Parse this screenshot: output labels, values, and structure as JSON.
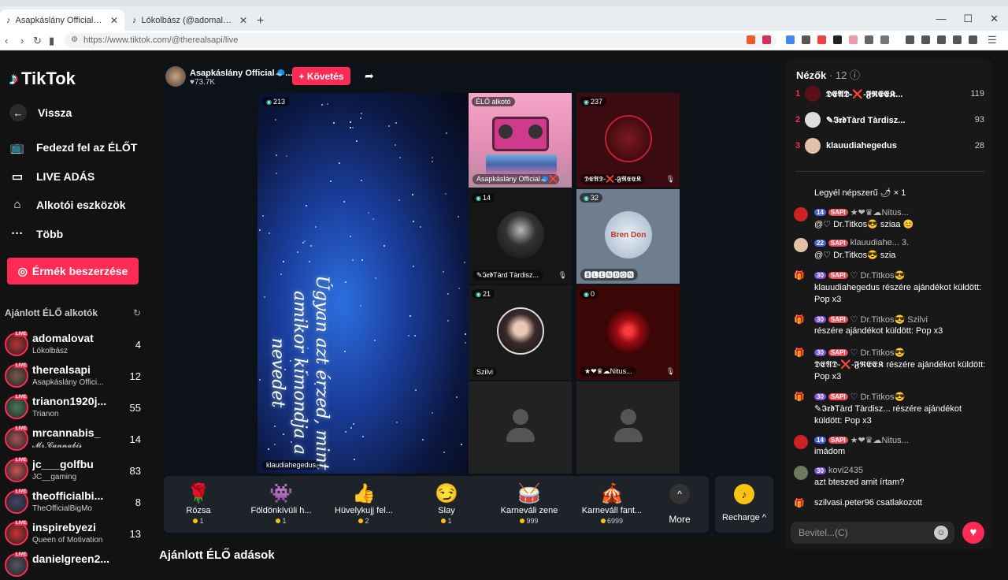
{
  "browser": {
    "tabs": [
      {
        "title": "Asapkáslány Official🧢❌ (@"
      },
      {
        "title": "Lókolbász (@adomalovat) ÉLŐ adásb"
      }
    ],
    "url": "https://www.tiktok.com/@therealsapi/live"
  },
  "sidebar": {
    "logo": "TikTok",
    "back": "Vissza",
    "nav": [
      "Fedezd fel az ÉLŐT",
      "LIVE ADÁS",
      "Alkotói eszközök",
      "Több"
    ],
    "coins_button": "Érmék beszerzése",
    "suggested_title": "Ajánlott ÉLŐ alkotók",
    "live_tag": "LIVE",
    "suggested": [
      {
        "name": "adomalovat",
        "sub": "Lókolbász",
        "count": "4"
      },
      {
        "name": "therealsapi",
        "sub": "Asapkáslány Offici...",
        "count": "12"
      },
      {
        "name": "trianon1920j...",
        "sub": "Trianon",
        "count": "55"
      },
      {
        "name": "mrcannabis_",
        "sub": "𝓜𝓻.𝓒𝓪𝓷𝓷𝓪𝓫𝓲𝓼",
        "count": "14"
      },
      {
        "name": "jc___golfbu",
        "sub": "JC__gaming",
        "count": "83"
      },
      {
        "name": "theofficialbi...",
        "sub": "TheOfficialBigMo",
        "count": "8"
      },
      {
        "name": "inspirebyezi",
        "sub": "Queen of Motivation",
        "count": "13"
      },
      {
        "name": "danielgreen2...",
        "sub": "",
        "count": ""
      }
    ]
  },
  "host": {
    "name": "Asapkáslány Official🧢...",
    "likes": "♥73.7K",
    "follow": "+ Követés"
  },
  "main_video": {
    "viewers": "213",
    "poem": "Úgyan azt érzed, mint amikor kimondja a nevedet",
    "label": "klaudiahegedus"
  },
  "tiles": [
    {
      "badge": "ÉLŐ alkotó",
      "label": "Asapkáslány Official🧢❌"
    },
    {
      "badge": "237",
      "label": "𝕯𝕰𝕬𝕯-❌-𝕱𝕽𝕰𝕰𝕶"
    },
    {
      "badge": "14",
      "label": "✎𝕴𝖗𝖉Tàrd Tàrdisz..."
    },
    {
      "badge": "32",
      "label": "🅱🅻🅴🅽🅳🅾🅽"
    },
    {
      "badge": "21",
      "label": "Szilvi"
    },
    {
      "badge": "0",
      "label": "★❤♛☁Nitus..."
    }
  ],
  "tile_art": {
    "bren": "Bren Don"
  },
  "gifts": [
    {
      "icon": "🌹",
      "name": "Rózsa",
      "price": "1"
    },
    {
      "icon": "👾",
      "name": "Földönkívüli h...",
      "price": "1"
    },
    {
      "icon": "👍",
      "name": "Hüvelykujj fel...",
      "price": "2"
    },
    {
      "icon": "😏",
      "name": "Slay",
      "price": "1"
    },
    {
      "icon": "🥁",
      "name": "Karneváli zene",
      "price": "999"
    },
    {
      "icon": "🎪",
      "name": "Karneváll fant...",
      "price": "6999"
    }
  ],
  "more": "More",
  "recharge": "Recharge ^",
  "recommended_title": "Ajánlott ÉLŐ adások",
  "viewers": {
    "title": "Nézők",
    "count": "· 12",
    "top": [
      {
        "rank": "1",
        "name": "𝕯𝕰𝕬𝕯-❌-𝕱𝕽𝕰𝕰𝕶...",
        "score": "119"
      },
      {
        "rank": "2",
        "name": "✎𝕴𝖗𝖉Tàrd Tàrdisz...",
        "score": "93"
      },
      {
        "rank": "3",
        "name": "klauudiahegedus",
        "score": "28"
      }
    ]
  },
  "chat": [
    {
      "l1": "",
      "l2": "Legyél népszerű 🌶 × 1",
      "pills": []
    },
    {
      "pills": [
        {
          "t": "14",
          "c": "b"
        },
        {
          "t": "SAPI",
          "c": "r"
        }
      ],
      "l1": "★❤♛☁Nitus...",
      "l2": "@♡ Dr.Titkos😎  sziaa 😊"
    },
    {
      "pills": [
        {
          "t": "22",
          "c": "b"
        },
        {
          "t": "SAPI",
          "c": "r"
        }
      ],
      "l1": "klauudiahe... 3.",
      "l2": "@♡ Dr.Titkos😎  szia"
    },
    {
      "pills": [
        {
          "t": "30",
          "c": "p"
        },
        {
          "t": "SAPI",
          "c": "r"
        }
      ],
      "l1": "♡ Dr.Titkos😎",
      "l2": "klauudiahegedus részére ajándékot küldött: Pop x3"
    },
    {
      "pills": [
        {
          "t": "30",
          "c": "p"
        },
        {
          "t": "SAPI",
          "c": "r"
        }
      ],
      "l1": "♡ Dr.Titkos😎  Szilvi",
      "l2": "részére ajándékot küldött: Pop x3"
    },
    {
      "pills": [
        {
          "t": "30",
          "c": "p"
        },
        {
          "t": "SAPI",
          "c": "r"
        }
      ],
      "l1": "♡ Dr.Titkos😎",
      "l2": "𝕯𝕰𝕬𝕯-❌-𝕱𝕽𝕰𝕰𝕶 részére ajándékot küldött: Pop x3"
    },
    {
      "pills": [
        {
          "t": "30",
          "c": "p"
        },
        {
          "t": "SAPI",
          "c": "r"
        }
      ],
      "l1": "♡ Dr.Titkos😎",
      "l2": "✎𝕴𝖗𝖉Tàrd Tàrdisz... részére ajándékot küldött: Pop x3"
    },
    {
      "pills": [
        {
          "t": "14",
          "c": "b"
        },
        {
          "t": "SAPI",
          "c": "r"
        }
      ],
      "l1": "★❤♛☁Nitus...",
      "l2": "imádom"
    },
    {
      "pills": [
        {
          "t": "30",
          "c": "p"
        }
      ],
      "l1": "kovi2435",
      "l2": "azt bteszed amit írtam?"
    },
    {
      "pills": [],
      "l1": "szilvasi.peter96  csatlakozott",
      "l2": ""
    }
  ],
  "input_placeholder": "Bevitel...(C)"
}
